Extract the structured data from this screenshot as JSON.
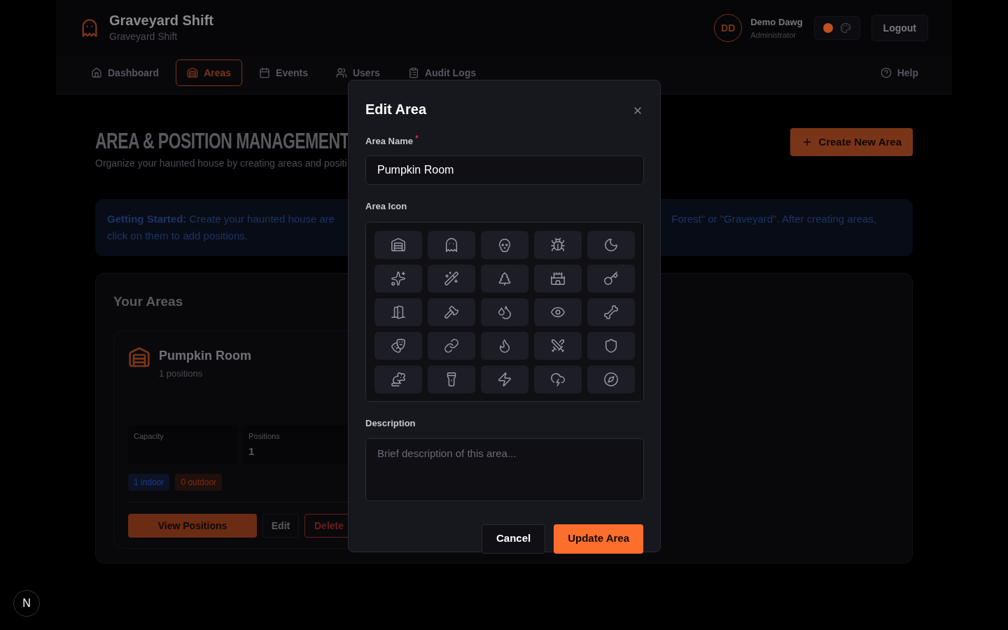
{
  "header": {
    "app_title": "Graveyard Shift",
    "app_subtitle": "Graveyard Shift",
    "user": {
      "initials": "DD",
      "name": "Demo Dawg",
      "role": "Administrator"
    },
    "theme_swatches": [
      {
        "color": "#c2501f",
        "selected": true
      }
    ],
    "logout": "Logout"
  },
  "nav": {
    "items": [
      {
        "label": "Dashboard",
        "selected": false
      },
      {
        "label": "Areas",
        "selected": true
      },
      {
        "label": "Events",
        "selected": false
      },
      {
        "label": "Users",
        "selected": false
      },
      {
        "label": "Audit Logs",
        "selected": false
      }
    ],
    "help": "Help"
  },
  "page": {
    "title": "AREA & POSITION MANAGEMENT",
    "subtitle": "Organize your haunted house by creating areas and positi",
    "create_button": "Create New Area"
  },
  "banner": {
    "left_lines": [
      "**Getting Started:** Create your haunted house are",
      "click on them to add positions."
    ],
    "right_text": "Forest\" or \"Graveyard\". After creating areas,"
  },
  "areas": {
    "title": "Your Areas",
    "cards": [
      {
        "name": "Pumpkin Room",
        "count": "1 positions",
        "stats": [
          {
            "label": "Capacity"
          },
          {
            "label": "Positions",
            "value": "1"
          }
        ],
        "badges": [
          {
            "text": "1 indoor",
            "color": "#1e3a8a"
          },
          {
            "text": "0 outdoor",
            "color": "#7c2d12"
          }
        ],
        "view_button": "View Positions",
        "edit_button": "Edit",
        "delete_button": "Delete"
      }
    ]
  },
  "modal": {
    "title": "Edit Area",
    "name_label": "Area Name",
    "required_mark": "*",
    "name_value": "Pumpkin Room",
    "icon_label": "Area Icon",
    "description_label": "Description",
    "description_placeholder": "Brief description of this area...",
    "cancel": "Cancel",
    "submit": "Update Area"
  },
  "dev_badge": "N"
}
